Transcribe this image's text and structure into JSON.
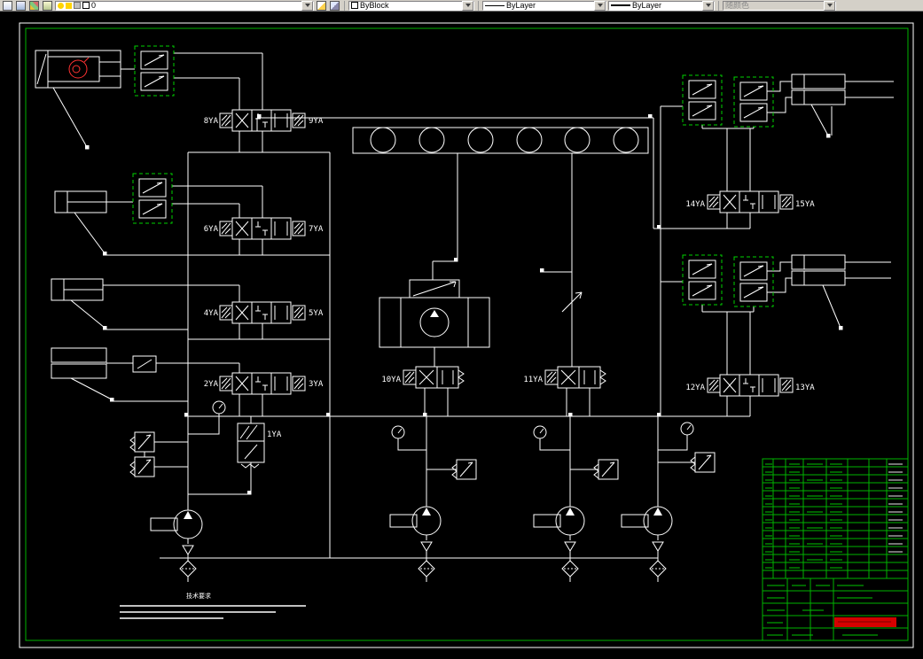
{
  "toolbar": {
    "layer_value": "0",
    "color_value": "ByBlock",
    "linetype_value": "ByLayer",
    "lineweight_value": "ByLayer",
    "plot_style_value": "随颜色"
  },
  "schematic": {
    "labels": {
      "ya1": "1YA",
      "ya2": "2YA",
      "ya3": "3YA",
      "ya4": "4YA",
      "ya5": "5YA",
      "ya6": "6YA",
      "ya7": "7YA",
      "ya8": "8YA",
      "ya9": "9YA",
      "ya10": "10YA",
      "ya11": "11YA",
      "ya12": "12YA",
      "ya13": "13YA",
      "ya14": "14YA",
      "ya15": "15YA"
    },
    "notes_title": "技术要求",
    "colors": {
      "canvas_background": "#000000",
      "line_white": "#ffffff",
      "frame_green": "#00b400",
      "module_green": "#00d200",
      "highlight_red": "#ff3232",
      "title_block_red": "#d40000"
    }
  }
}
